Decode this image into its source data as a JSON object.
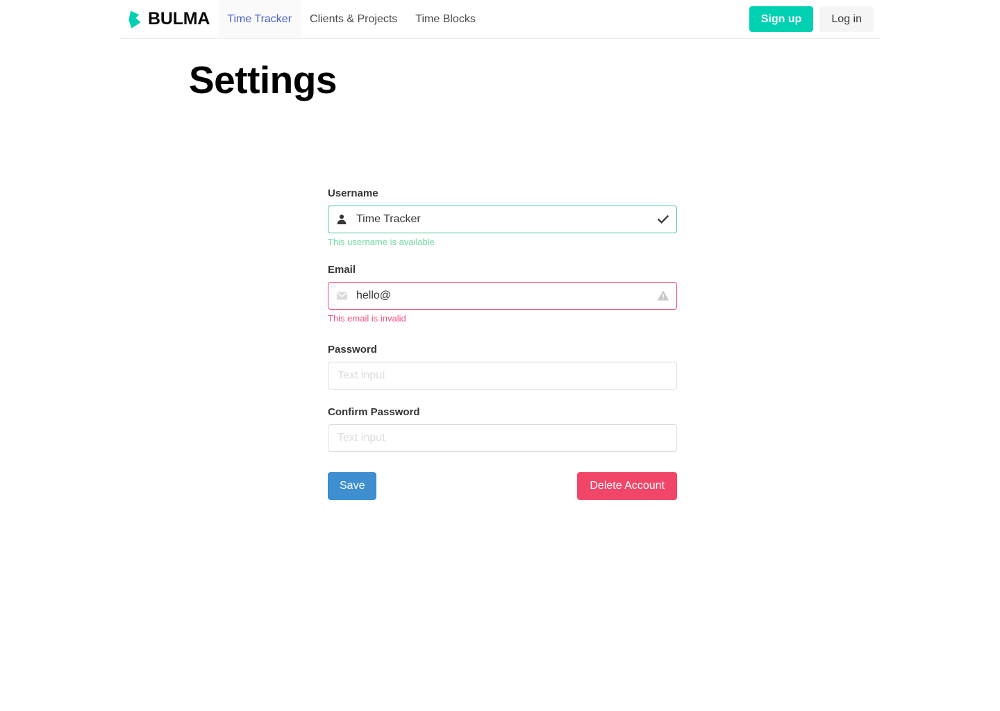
{
  "navbar": {
    "brand": {
      "name": "BULMA",
      "logo_icon": "bulma-logo-icon"
    },
    "items": [
      {
        "label": "Time Tracker",
        "active": true
      },
      {
        "label": "Clients & Projects",
        "active": false
      },
      {
        "label": "Time Blocks",
        "active": false
      }
    ],
    "signup_label": "Sign up",
    "login_label": "Log in",
    "signup_color": "#00d1b2",
    "active_item_color": "#485fc7"
  },
  "page": {
    "title": "Settings"
  },
  "form": {
    "username": {
      "label": "Username",
      "value": "Time Tracker",
      "placeholder": "",
      "help": "This username is available",
      "state": "success",
      "state_color": "#48c78e",
      "left_icon": "user-icon",
      "right_icon": "check-icon"
    },
    "email": {
      "label": "Email",
      "value": "hello@",
      "placeholder": "",
      "help": "This email is invalid",
      "state": "danger",
      "state_color": "#f14668",
      "left_icon": "envelope-icon",
      "right_icon": "warning-triangle-icon"
    },
    "password": {
      "label": "Password",
      "value": "",
      "placeholder": "Text input"
    },
    "confirm_password": {
      "label": "Confirm Password",
      "value": "",
      "placeholder": "Text input"
    },
    "save_label": "Save",
    "save_color": "#3e8ed0",
    "delete_label": "Delete Account",
    "delete_color": "#f14668"
  }
}
